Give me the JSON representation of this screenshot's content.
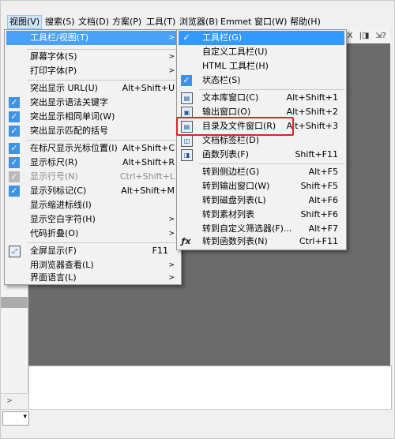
{
  "menubar": [
    {
      "label": "视图(V)",
      "active": true
    },
    {
      "label": "搜索(S)"
    },
    {
      "label": "文档(D)"
    },
    {
      "label": "方案(P)"
    },
    {
      "label": "工具(T)"
    },
    {
      "label": "浏览器(B)"
    },
    {
      "label": "Emmet"
    },
    {
      "label": "窗口(W)"
    },
    {
      "label": "帮助(H)"
    }
  ],
  "toolbar_tail": {
    "btn1": "X",
    "btn2": "|◨",
    "btn3": "⇲?"
  },
  "view_menu": {
    "items": [
      {
        "label": "工具栏/视图(T)",
        "submenu": true,
        "highlight": true
      },
      {
        "label": "屏幕字体(S)",
        "submenu": true
      },
      {
        "label": "打印字体(P)",
        "submenu": true
      },
      {
        "label": "突出显示 URL(U)",
        "shortcut": "Alt+Shift+U"
      },
      {
        "label": "突出显示语法关键字",
        "checked": true
      },
      {
        "label": "突出显示相同单词(W)",
        "checked": true
      },
      {
        "label": "突出显示匹配的括号",
        "checked": true
      },
      {
        "label": "在标尺显示光标位置(I)",
        "shortcut": "Alt+Shift+C",
        "checked": true
      },
      {
        "label": "显示标尺(R)",
        "shortcut": "Alt+Shift+R",
        "checked": true
      },
      {
        "label": "显示行号(N)",
        "shortcut": "Ctrl+Shift+L",
        "checked": true,
        "disabled": true
      },
      {
        "label": "显示列标记(C)",
        "shortcut": "Alt+Shift+M",
        "checked": true
      },
      {
        "label": "显示缩进标线(I)"
      },
      {
        "label": "显示空白字符(H)",
        "submenu": true
      },
      {
        "label": "代码折叠(O)",
        "submenu": true
      },
      {
        "label": "全屏显示(F)",
        "shortcut": "F11",
        "icon": "fullscreen-icon"
      },
      {
        "label": "用浏览器查看(L)",
        "submenu": true
      },
      {
        "label": "界面语言(L)",
        "submenu": true
      }
    ]
  },
  "toolbar_submenu": {
    "items": [
      {
        "label": "工具栏(G)",
        "checked": true,
        "highlight": true
      },
      {
        "label": "自定义工具栏(U)"
      },
      {
        "label": "HTML 工具栏(H)"
      },
      {
        "label": "状态栏(S)",
        "checked": true
      },
      {
        "label": "文本库窗口(C)",
        "shortcut": "Alt+Shift+1",
        "icon": "text-library-icon"
      },
      {
        "label": "输出窗口(O)",
        "shortcut": "Alt+Shift+2",
        "icon": "output-window-icon"
      },
      {
        "label": "目录及文件窗口(R)",
        "shortcut": "Alt+Shift+3",
        "icon": "directory-window-icon",
        "annotated": true
      },
      {
        "label": "文档标签栏(D)",
        "icon": "document-tabs-icon"
      },
      {
        "label": "函数列表(F)",
        "shortcut": "Shift+F11",
        "icon": "function-list-icon"
      },
      {
        "label": "转到侧边栏(G)",
        "shortcut": "Alt+F5"
      },
      {
        "label": "转到输出窗口(W)",
        "shortcut": "Shift+F5"
      },
      {
        "label": "转到磁盘列表(L)",
        "shortcut": "Alt+F6"
      },
      {
        "label": "转到素材列表",
        "shortcut": "Shift+F6"
      },
      {
        "label": "转到自定义筛选器(F)...",
        "shortcut": "Alt+F7"
      },
      {
        "label": "转到函数列表(N)",
        "shortcut": "Ctrl+F11",
        "icon": "fx-icon"
      }
    ]
  },
  "colors": {
    "highlight": "#3399ff",
    "annotation": "#e0212a",
    "editor_bg": "#6b6b6b"
  }
}
